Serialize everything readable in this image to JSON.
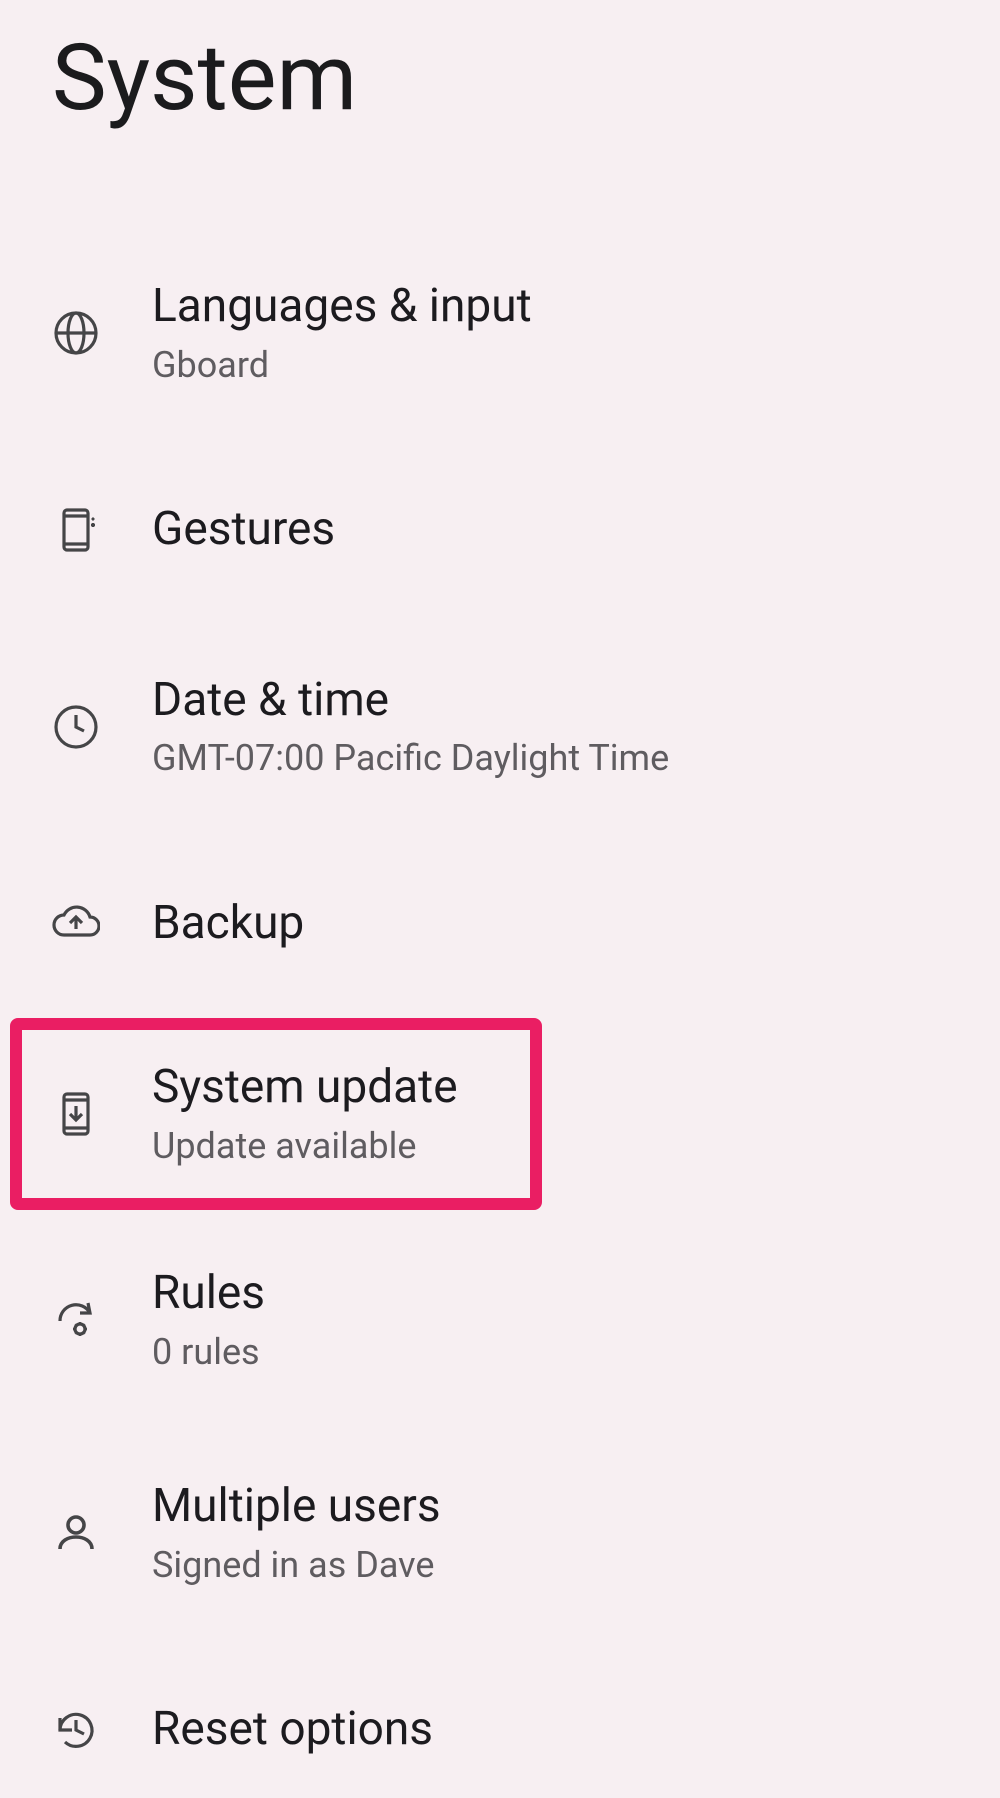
{
  "header": {
    "title": "System"
  },
  "items": {
    "languages": {
      "title": "Languages & input",
      "subtitle": "Gboard"
    },
    "gestures": {
      "title": "Gestures"
    },
    "datetime": {
      "title": "Date & time",
      "subtitle": "GMT-07:00 Pacific Daylight Time"
    },
    "backup": {
      "title": "Backup"
    },
    "sysupdate": {
      "title": "System update",
      "subtitle": "Update available"
    },
    "rules": {
      "title": "Rules",
      "subtitle": "0 rules"
    },
    "users": {
      "title": "Multiple users",
      "subtitle": "Signed in as Dave"
    },
    "reset": {
      "title": "Reset options"
    }
  }
}
